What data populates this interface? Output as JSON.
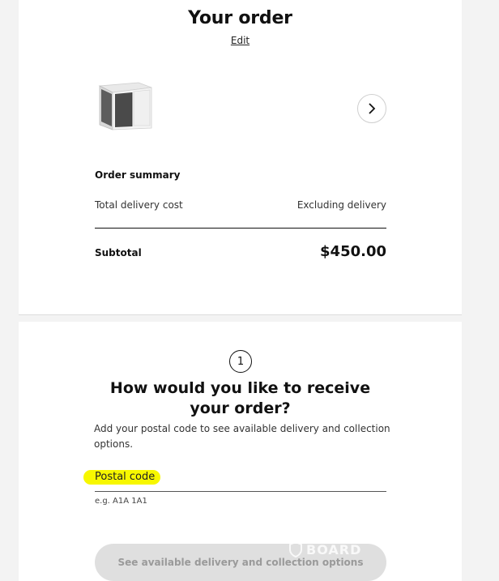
{
  "order": {
    "title": "Your order",
    "edit_label": "Edit",
    "product_image_icon": "kitchen-cabinet-image",
    "next_icon": "chevron-right-icon"
  },
  "summary": {
    "heading": "Order summary",
    "delivery_label": "Total delivery cost",
    "delivery_value": "Excluding delivery",
    "subtotal_label": "Subtotal",
    "subtotal_value": "$450.00"
  },
  "delivery": {
    "step_number": "1",
    "heading": "How would you like to receive your order?",
    "description": "Add your postal code to see available delivery and collection options.",
    "postal_label": "Postal code",
    "postal_value": "",
    "postal_hint": "e.g. A1A 1A1",
    "cta_label": "See available delivery and collection options"
  },
  "watermark": {
    "text": "BOARD",
    "icon": "shield-icon"
  },
  "colors": {
    "highlight": "#f7f700",
    "cta_bg": "#dfdfdf",
    "cta_text": "#9a9a9a"
  }
}
